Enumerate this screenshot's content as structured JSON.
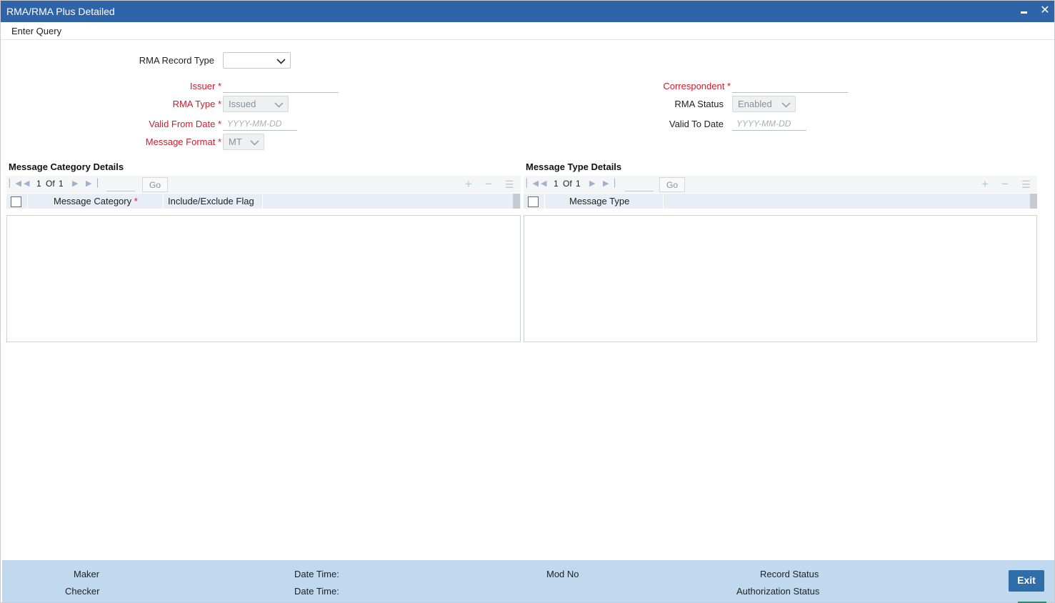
{
  "window": {
    "title": "RMA/RMA Plus Detailed",
    "minimize_icon": "minimize-icon",
    "close_icon": "close-icon",
    "close_glyph": "✕"
  },
  "toolbar": {
    "enter_query": "Enter Query"
  },
  "form": {
    "rma_record_type": {
      "label": "RMA Record Type",
      "value": ""
    },
    "issuer": {
      "label": "Issuer",
      "value": ""
    },
    "rma_type": {
      "label": "RMA Type",
      "value": "Issued"
    },
    "valid_from_date": {
      "label": "Valid From Date",
      "placeholder": "YYYY-MM-DD"
    },
    "message_format": {
      "label": "Message Format",
      "value": "MT"
    },
    "correspondent": {
      "label": "Correspondent",
      "value": ""
    },
    "rma_status": {
      "label": "RMA Status",
      "value": "Enabled"
    },
    "valid_to_date": {
      "label": "Valid To Date",
      "placeholder": "YYYY-MM-DD"
    }
  },
  "category_grid": {
    "title": "Message Category Details",
    "page_current": "1",
    "page_of": "Of",
    "page_total": "1",
    "go_label": "Go",
    "columns": [
      "Message Category",
      "Include/Exclude Flag"
    ],
    "required_marker": "*",
    "rows": []
  },
  "type_grid": {
    "title": "Message Type Details",
    "page_current": "1",
    "page_of": "Of",
    "page_total": "1",
    "go_label": "Go",
    "columns": [
      "Message Type"
    ],
    "rows": []
  },
  "footer": {
    "maker": "Maker",
    "checker": "Checker",
    "date_time_1": "Date Time:",
    "date_time_2": "Date Time:",
    "mod_no": "Mod No",
    "record_status": "Record Status",
    "authorization_status": "Authorization Status",
    "exit": "Exit"
  },
  "colors": {
    "titlebar": "#2f64a8",
    "required": "#d21a2a",
    "footer": "#c0d9ee",
    "exit_button": "#2f6ea9"
  }
}
